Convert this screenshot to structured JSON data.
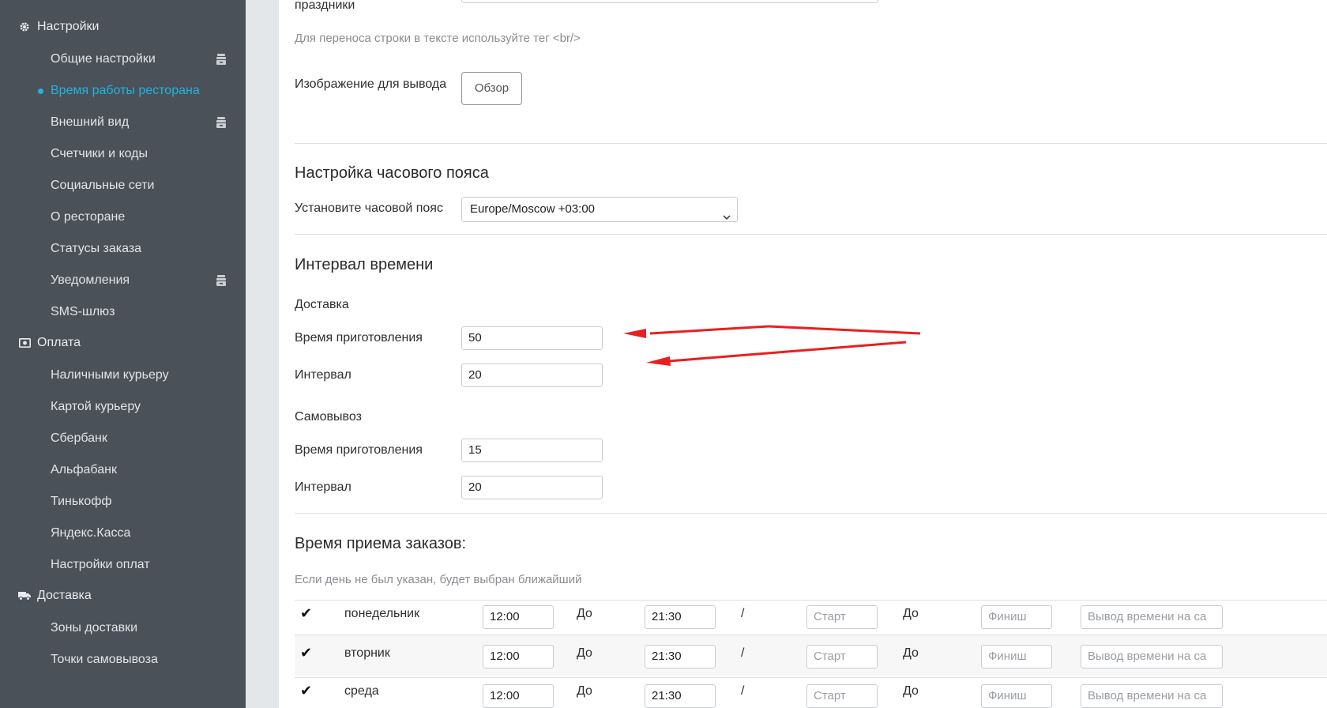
{
  "sidebar": {
    "sections": [
      {
        "label": "Настройки",
        "icon": "gear-icon"
      },
      {
        "label": "Оплата",
        "icon": "money-icon"
      },
      {
        "label": "Доставка",
        "icon": "truck-icon"
      }
    ],
    "settings_items": [
      "Общие настройки",
      "Время работы ресторана",
      "Внешний вид",
      "Счетчики и коды",
      "Социальные сети",
      "О ресторане",
      "Статусы заказа",
      "Уведомления",
      "SMS-шлюз"
    ],
    "payment_items": [
      "Наличными курьеру",
      "Картой курьеру",
      "Сбербанк",
      "Альфабанк",
      "Тинькофф",
      "Яндекс.Касса",
      "Настройки оплат"
    ],
    "delivery_items": [
      "Зоны доставки",
      "Точки самовывоза"
    ],
    "active_item": "Время работы ресторана"
  },
  "main": {
    "holidays_label": "праздники",
    "br_hint": "Для переноса строки в тексте используйте тег <br/>",
    "image_label": "Изображение для вывода",
    "browse_button": "Обзор",
    "timezone": {
      "title": "Настройка часового пояса",
      "label": "Установите часовой пояс",
      "value": "Europe/Moscow +03:00"
    },
    "interval": {
      "title": "Интервал времени",
      "delivery": {
        "title": "Доставка",
        "prep_label": "Время приготовления",
        "prep_value": "50",
        "interval_label": "Интервал",
        "interval_value": "20"
      },
      "pickup": {
        "title": "Самовывоз",
        "prep_label": "Время приготовления",
        "prep_value": "15",
        "interval_label": "Интервал",
        "interval_value": "20"
      }
    },
    "orders": {
      "title": "Время приема заказов:",
      "hint": "Если день не был указан, будет выбран ближайший",
      "to_label": "До",
      "slash": "/",
      "start_placeholder": "Старт",
      "finish_placeholder": "Финиш",
      "site_placeholder": "Вывод времени на са",
      "days": [
        {
          "name": "понедельник",
          "checked": true,
          "from": "12:00",
          "to": "21:30"
        },
        {
          "name": "вторник",
          "checked": true,
          "from": "12:00",
          "to": "21:30"
        },
        {
          "name": "среда",
          "checked": true,
          "from": "12:00",
          "to": "21:30"
        }
      ]
    }
  },
  "colors": {
    "sidebar_bg": "#4b5159",
    "accent": "#22b3e0",
    "annotation_arrow": "#e8201f"
  }
}
